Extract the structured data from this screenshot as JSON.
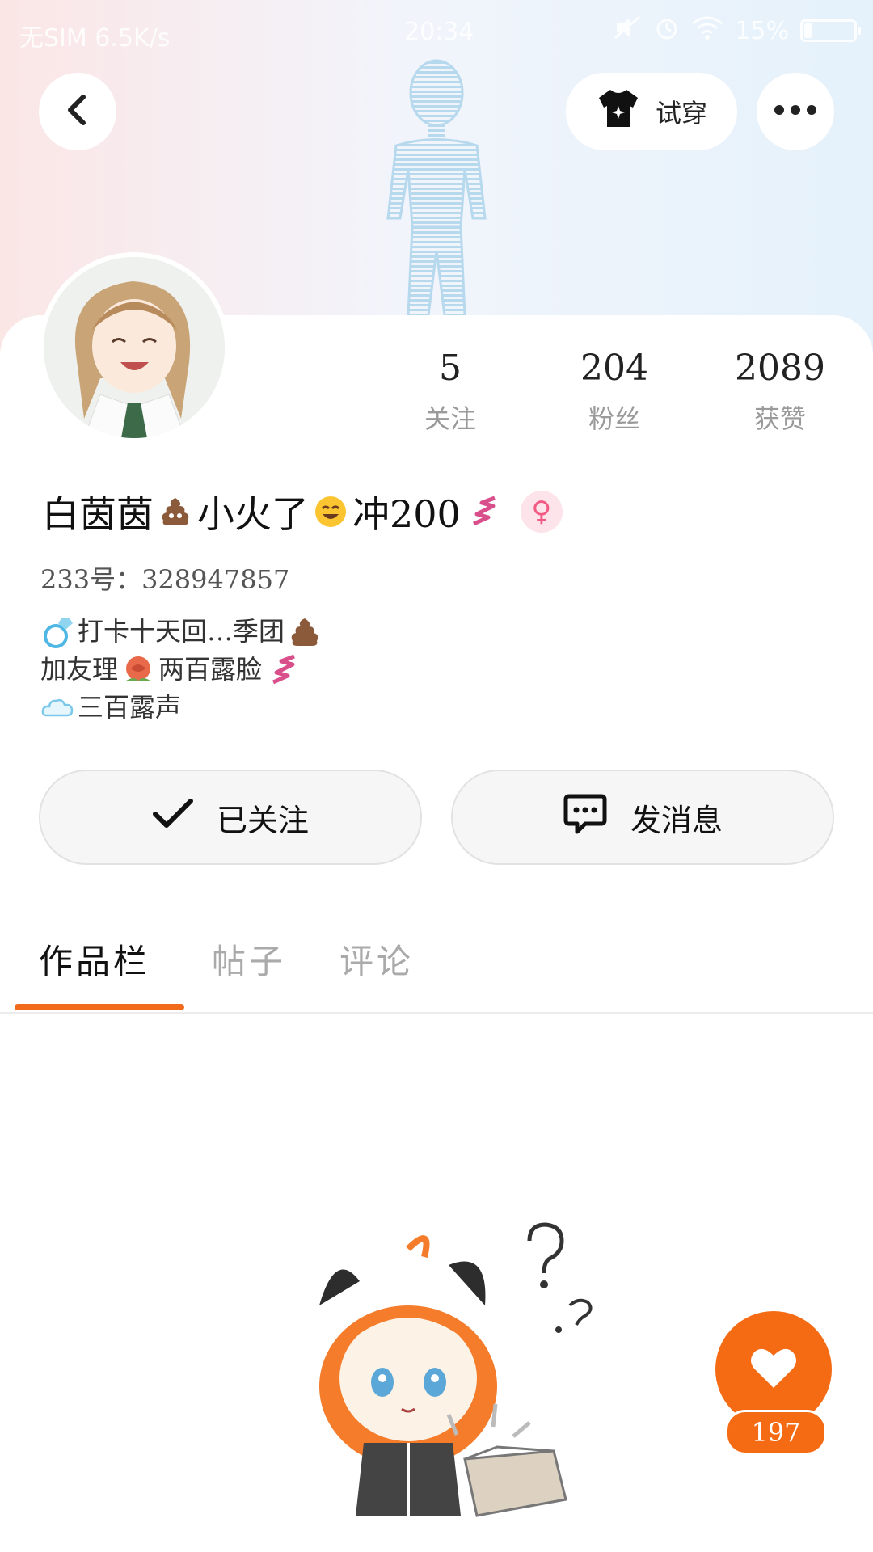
{
  "status_bar": {
    "carrier": "无SIM 6.5K/s",
    "time": "20:34",
    "battery": "15%",
    "battery_level": 0.15
  },
  "header": {
    "tryon_label": "试穿"
  },
  "profile": {
    "stats": [
      {
        "value": "5",
        "label": "关注"
      },
      {
        "value": "204",
        "label": "粉丝"
      },
      {
        "value": "2089",
        "label": "获赞"
      }
    ],
    "name_parts": [
      "白茵茵",
      "小火了",
      "冲200"
    ],
    "gender": "♀",
    "id_line": "233号：328947857",
    "bio_lines": [
      "打卡十天回…季团",
      "加友理",
      "两百露脸",
      "三百露声"
    ]
  },
  "actions": {
    "following_label": "已关注",
    "message_label": "发消息"
  },
  "tabs": [
    {
      "label": "作品栏"
    },
    {
      "label": "帖子"
    },
    {
      "label": "评论"
    }
  ],
  "like": {
    "count": "197"
  },
  "colors": {
    "accent": "#f56b14",
    "gender": "#f25a84"
  },
  "icons": [
    "back-arrow-icon",
    "tshirt-icon",
    "more-icon",
    "check-icon",
    "chat-bubble-icon",
    "heart-icon",
    "female-icon"
  ]
}
